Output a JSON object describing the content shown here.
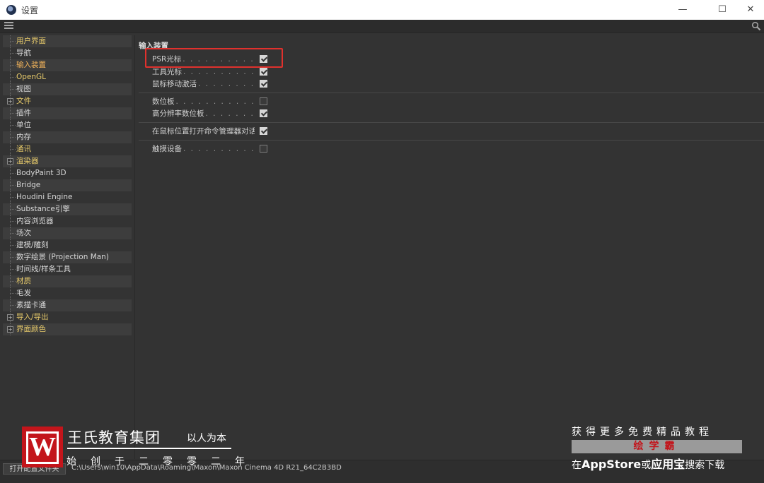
{
  "window": {
    "title": "设置",
    "minimize": "—",
    "maximize": "☐",
    "close": "✕"
  },
  "sidebar": {
    "items": [
      {
        "label": "用户界面",
        "expandable": false,
        "style": "yellow"
      },
      {
        "label": "导航",
        "expandable": false,
        "style": "white"
      },
      {
        "label": "输入装置",
        "expandable": false,
        "style": "active"
      },
      {
        "label": "OpenGL",
        "expandable": false,
        "style": "yellow"
      },
      {
        "label": "视图",
        "expandable": false,
        "style": "white"
      },
      {
        "label": "文件",
        "expandable": true,
        "style": "yellow"
      },
      {
        "label": "插件",
        "expandable": false,
        "style": "white"
      },
      {
        "label": "单位",
        "expandable": false,
        "style": "white"
      },
      {
        "label": "内存",
        "expandable": false,
        "style": "white"
      },
      {
        "label": "通讯",
        "expandable": false,
        "style": "yellow"
      },
      {
        "label": "渲染器",
        "expandable": true,
        "style": "yellow"
      },
      {
        "label": "BodyPaint 3D",
        "expandable": false,
        "style": "white"
      },
      {
        "label": "Bridge",
        "expandable": false,
        "style": "white"
      },
      {
        "label": "Houdini Engine",
        "expandable": false,
        "style": "white"
      },
      {
        "label": "Substance引擎",
        "expandable": false,
        "style": "white"
      },
      {
        "label": "内容浏览器",
        "expandable": false,
        "style": "white"
      },
      {
        "label": "场次",
        "expandable": false,
        "style": "white"
      },
      {
        "label": "建模/雕刻",
        "expandable": false,
        "style": "white"
      },
      {
        "label": "数字绘景 (Projection Man)",
        "expandable": false,
        "style": "white"
      },
      {
        "label": "时间线/样条工具",
        "expandable": false,
        "style": "white"
      },
      {
        "label": "材质",
        "expandable": false,
        "style": "yellow"
      },
      {
        "label": "毛发",
        "expandable": false,
        "style": "white"
      },
      {
        "label": "素描卡通",
        "expandable": false,
        "style": "white"
      },
      {
        "label": "导入/导出",
        "expandable": true,
        "style": "yellow"
      },
      {
        "label": "界面颜色",
        "expandable": true,
        "style": "yellow"
      }
    ]
  },
  "main": {
    "section_title": "输入装置",
    "options": [
      {
        "label": "PSR光标",
        "checked": true
      },
      {
        "label": "工具光标",
        "checked": true
      },
      {
        "label": "鼠标移动激活",
        "checked": true
      },
      {
        "label": "数位板",
        "checked": false
      },
      {
        "label": "高分辨率数位板",
        "checked": true
      },
      {
        "label": "在鼠标位置打开命令管理器对话框",
        "checked": true
      },
      {
        "label": "触摸设备",
        "checked": false
      }
    ]
  },
  "footer": {
    "open_folder_label": "打开配置文件夹",
    "path": "C:\\Users\\win10\\AppData\\Roaming\\Maxon\\Maxon Cinema 4D R21_64C2B3BD"
  },
  "watermark_left": {
    "logo_letter": "W",
    "name": "王氏教育集团",
    "slogan": "以人为本",
    "since": "始创于二零零二年"
  },
  "watermark_right": {
    "line1": "获得更多免费精品教程",
    "brand": "绘学霸",
    "line3_a": "在",
    "line3_b": "AppStore",
    "line3_c": "或",
    "line3_d": "应用宝",
    "line3_e": "搜索下载"
  },
  "colors": {
    "background": "#333333",
    "highlight_box": "#e0312d",
    "active_item": "#f3b45a",
    "category_item": "#e6c96a",
    "logo_red": "#c3151b"
  }
}
